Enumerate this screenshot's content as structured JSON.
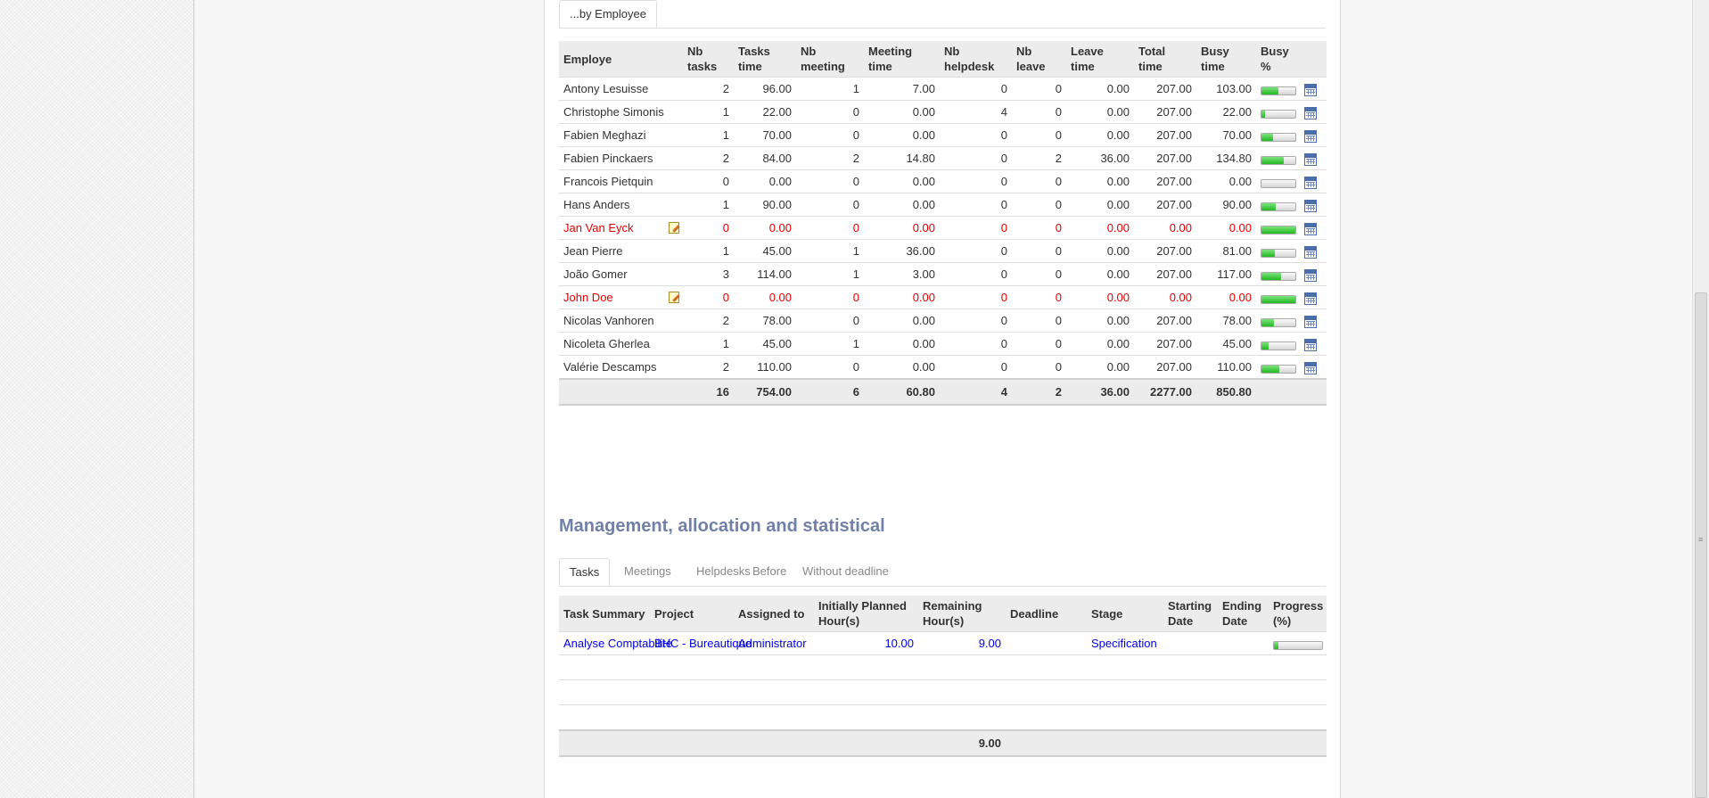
{
  "employee_tab": {
    "label": "...by Employee"
  },
  "employee_table": {
    "headers": {
      "employe": "Employe",
      "nb_tasks": "Nb tasks",
      "tasks_time": "Tasks time",
      "nb_meeting": "Nb meeting",
      "meeting_time": "Meeting time",
      "nb_helpdesk": "Nb helpdesk",
      "nb_leave": "Nb leave",
      "leave_time": "Leave time",
      "total_time": "Total time",
      "busy_time": "Busy time",
      "busy_pct": "Busy %"
    },
    "rows": [
      {
        "name": "Antony Lesuisse",
        "nb_tasks": "2",
        "tasks_time": "96.00",
        "nb_meeting": "1",
        "meeting_time": "7.00",
        "nb_helpdesk": "0",
        "nb_leave": "0",
        "leave_time": "0.00",
        "total_time": "207.00",
        "busy_time": "103.00",
        "busy_fraction": 0.5,
        "highlight": false
      },
      {
        "name": "Christophe Simonis",
        "nb_tasks": "1",
        "tasks_time": "22.00",
        "nb_meeting": "0",
        "meeting_time": "0.00",
        "nb_helpdesk": "4",
        "nb_leave": "0",
        "leave_time": "0.00",
        "total_time": "207.00",
        "busy_time": "22.00",
        "busy_fraction": 0.11,
        "highlight": false
      },
      {
        "name": "Fabien Meghazi",
        "nb_tasks": "1",
        "tasks_time": "70.00",
        "nb_meeting": "0",
        "meeting_time": "0.00",
        "nb_helpdesk": "0",
        "nb_leave": "0",
        "leave_time": "0.00",
        "total_time": "207.00",
        "busy_time": "70.00",
        "busy_fraction": 0.34,
        "highlight": false
      },
      {
        "name": "Fabien Pinckaers",
        "nb_tasks": "2",
        "tasks_time": "84.00",
        "nb_meeting": "2",
        "meeting_time": "14.80",
        "nb_helpdesk": "0",
        "nb_leave": "2",
        "leave_time": "36.00",
        "total_time": "207.00",
        "busy_time": "134.80",
        "busy_fraction": 0.65,
        "highlight": false
      },
      {
        "name": "Francois Pietquin",
        "nb_tasks": "0",
        "tasks_time": "0.00",
        "nb_meeting": "0",
        "meeting_time": "0.00",
        "nb_helpdesk": "0",
        "nb_leave": "0",
        "leave_time": "0.00",
        "total_time": "207.00",
        "busy_time": "0.00",
        "busy_fraction": 0,
        "highlight": false
      },
      {
        "name": "Hans Anders",
        "nb_tasks": "1",
        "tasks_time": "90.00",
        "nb_meeting": "0",
        "meeting_time": "0.00",
        "nb_helpdesk": "0",
        "nb_leave": "0",
        "leave_time": "0.00",
        "total_time": "207.00",
        "busy_time": "90.00",
        "busy_fraction": 0.43,
        "highlight": false
      },
      {
        "name": "Jan Van Eyck",
        "nb_tasks": "0",
        "tasks_time": "0.00",
        "nb_meeting": "0",
        "meeting_time": "0.00",
        "nb_helpdesk": "0",
        "nb_leave": "0",
        "leave_time": "0.00",
        "total_time": "0.00",
        "busy_time": "0.00",
        "busy_fraction": 1,
        "highlight": true
      },
      {
        "name": "Jean Pierre",
        "nb_tasks": "1",
        "tasks_time": "45.00",
        "nb_meeting": "1",
        "meeting_time": "36.00",
        "nb_helpdesk": "0",
        "nb_leave": "0",
        "leave_time": "0.00",
        "total_time": "207.00",
        "busy_time": "81.00",
        "busy_fraction": 0.39,
        "highlight": false
      },
      {
        "name": "João Gomer",
        "nb_tasks": "3",
        "tasks_time": "114.00",
        "nb_meeting": "1",
        "meeting_time": "3.00",
        "nb_helpdesk": "0",
        "nb_leave": "0",
        "leave_time": "0.00",
        "total_time": "207.00",
        "busy_time": "117.00",
        "busy_fraction": 0.57,
        "highlight": false
      },
      {
        "name": "John Doe",
        "nb_tasks": "0",
        "tasks_time": "0.00",
        "nb_meeting": "0",
        "meeting_time": "0.00",
        "nb_helpdesk": "0",
        "nb_leave": "0",
        "leave_time": "0.00",
        "total_time": "0.00",
        "busy_time": "0.00",
        "busy_fraction": 1,
        "highlight": true
      },
      {
        "name": "Nicolas Vanhoren",
        "nb_tasks": "2",
        "tasks_time": "78.00",
        "nb_meeting": "0",
        "meeting_time": "0.00",
        "nb_helpdesk": "0",
        "nb_leave": "0",
        "leave_time": "0.00",
        "total_time": "207.00",
        "busy_time": "78.00",
        "busy_fraction": 0.38,
        "highlight": false
      },
      {
        "name": "Nicoleta Gherlea",
        "nb_tasks": "1",
        "tasks_time": "45.00",
        "nb_meeting": "1",
        "meeting_time": "0.00",
        "nb_helpdesk": "0",
        "nb_leave": "0",
        "leave_time": "0.00",
        "total_time": "207.00",
        "busy_time": "45.00",
        "busy_fraction": 0.22,
        "highlight": false
      },
      {
        "name": "Valérie Descamps",
        "nb_tasks": "2",
        "tasks_time": "110.00",
        "nb_meeting": "0",
        "meeting_time": "0.00",
        "nb_helpdesk": "0",
        "nb_leave": "0",
        "leave_time": "0.00",
        "total_time": "207.00",
        "busy_time": "110.00",
        "busy_fraction": 0.53,
        "highlight": false
      }
    ],
    "totals": {
      "nb_tasks": "16",
      "tasks_time": "754.00",
      "nb_meeting": "6",
      "meeting_time": "60.80",
      "nb_helpdesk": "4",
      "nb_leave": "2",
      "leave_time": "36.00",
      "total_time": "2277.00",
      "busy_time": "850.80"
    }
  },
  "management": {
    "title": "Management, allocation and statistical",
    "tabs": [
      "Tasks",
      "Meetings",
      "Helpdesks",
      "Before",
      "Without deadline"
    ],
    "active_tab": "Tasks",
    "headers": {
      "task_summary": "Task Summary",
      "project": "Project",
      "assigned_to": "Assigned to",
      "initially_planned": "Initially Planned Hour(s)",
      "remaining": "Remaining Hour(s)",
      "deadline": "Deadline",
      "stage": "Stage",
      "starting_date": "Starting Date",
      "ending_date": "Ending Date",
      "progress": "Progress (%)"
    },
    "rows": [
      {
        "task_summary": "Analyse Comptabilité",
        "project": "BHC - Bureautique",
        "assigned_to": "Administrator",
        "initially_planned": "10.00",
        "remaining": "9.00",
        "deadline": "",
        "stage": "Specification",
        "starting_date": "",
        "ending_date": "",
        "progress_fraction": 0.1
      }
    ],
    "totals": {
      "remaining": "9.00"
    }
  },
  "colors": {
    "accent_title": "#7080a8",
    "link": "#0000e0",
    "highlight_red": "#e20000",
    "progress_green": "#22b922"
  },
  "icons": {
    "calendar": "calendar-icon",
    "note": "edit-note-icon"
  }
}
